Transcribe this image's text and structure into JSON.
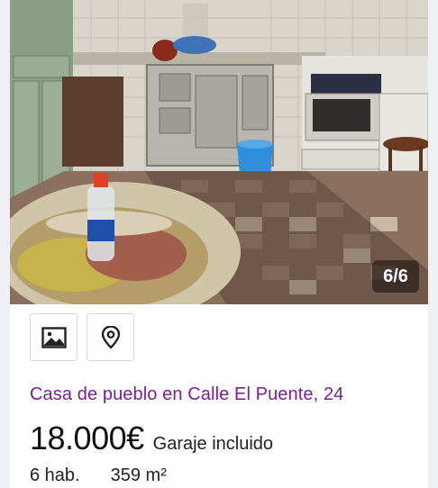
{
  "gallery": {
    "counter": "6/6",
    "description": "Kitchen with wood-burning stove, round table and tiled floor"
  },
  "actions": [
    {
      "icon": "image-icon"
    },
    {
      "icon": "map-pin-icon"
    }
  ],
  "listing": {
    "title": "Casa de pueblo en Calle El Puente, 24",
    "price": "18.000€",
    "price_extra": "Garaje incluido",
    "features": [
      "6 hab.",
      "359 m²"
    ]
  },
  "colors": {
    "title": "#7a1f8f",
    "price": "#111111",
    "background": "#eef0f3"
  }
}
